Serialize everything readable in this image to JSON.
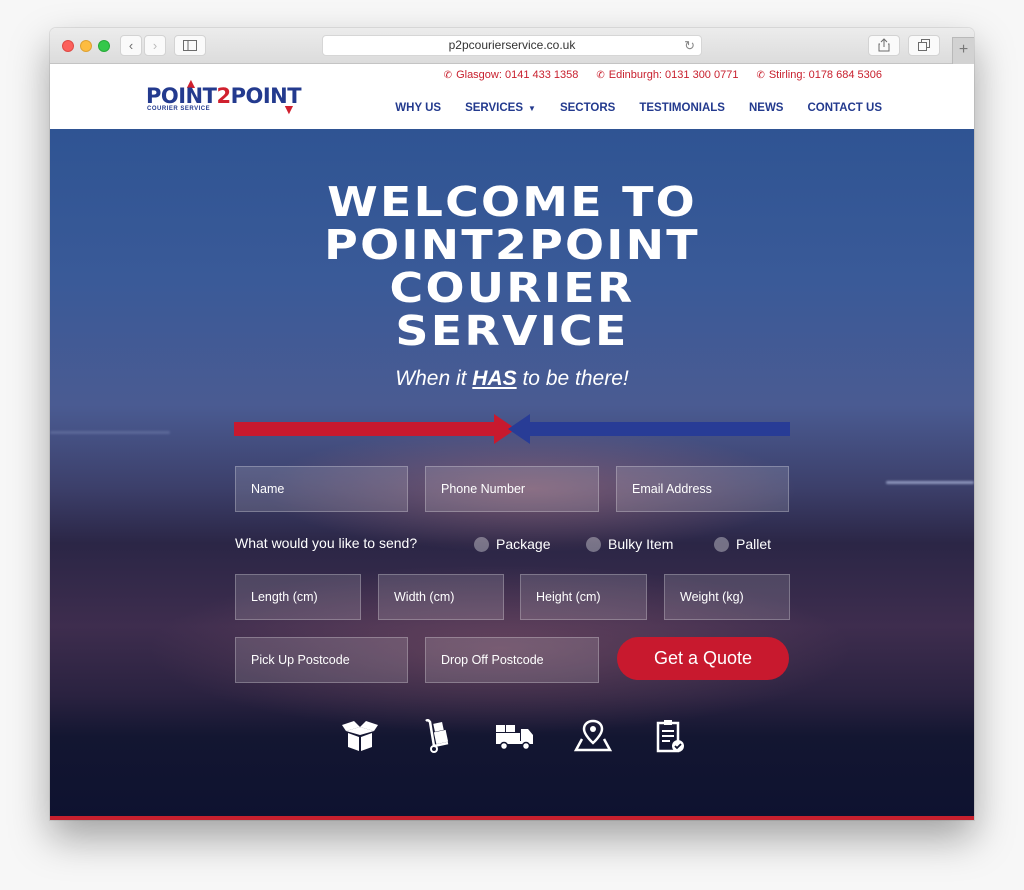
{
  "browser": {
    "url": "p2pcourierservice.co.uk",
    "back_icon": "‹",
    "forward_icon": "›",
    "new_tab_icon": "+"
  },
  "header": {
    "logo": {
      "part1": "POINT",
      "part2": "2",
      "part3": "POINT",
      "subtitle": "COURIER SERVICE"
    },
    "phones": [
      {
        "label": "Glasgow: 0141 433 1358"
      },
      {
        "label": "Edinburgh: 0131 300 0771"
      },
      {
        "label": "Stirling: 0178 684 5306"
      }
    ],
    "nav": [
      {
        "label": "WHY US"
      },
      {
        "label": "SERVICES",
        "has_dropdown": true
      },
      {
        "label": "SECTORS"
      },
      {
        "label": "TESTIMONIALS"
      },
      {
        "label": "NEWS"
      },
      {
        "label": "CONTACT US"
      }
    ],
    "colors": {
      "brand_blue": "#233a8e",
      "brand_red": "#c8202e"
    }
  },
  "hero": {
    "title_lines": [
      "WELCOME TO",
      "POINT2POINT",
      "COURIER",
      "SERVICE"
    ],
    "tagline": {
      "before": "When it ",
      "emphasis": "HAS",
      "after": " to be there!"
    },
    "form": {
      "name_placeholder": "Name",
      "phone_placeholder": "Phone Number",
      "email_placeholder": "Email Address",
      "question": "What would you like to send?",
      "options": [
        "Package",
        "Bulky Item",
        "Pallet"
      ],
      "length_placeholder": "Length (cm)",
      "width_placeholder": "Width (cm)",
      "height_placeholder": "Height (cm)",
      "weight_placeholder": "Weight (kg)",
      "pickup_placeholder": "Pick Up Postcode",
      "dropoff_placeholder": "Drop Off Postcode",
      "submit_label": "Get a Quote"
    },
    "icons": [
      "open-box-icon",
      "hand-truck-icon",
      "delivery-truck-icon",
      "map-pin-icon",
      "checklist-icon"
    ]
  }
}
